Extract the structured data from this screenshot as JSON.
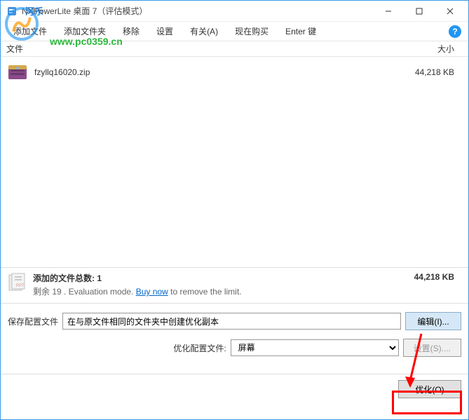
{
  "titlebar": {
    "title": "NXPowerLite 桌面 7（评估模式）"
  },
  "menubar": {
    "items": [
      "添加文件",
      "添加文件夹",
      "移除",
      "设置",
      "有关(A)",
      "现在购买",
      "Enter 键"
    ]
  },
  "list_header": {
    "file": "文件",
    "size": "大小"
  },
  "files": [
    {
      "name": "fzyllq16020.zip",
      "size": "44,218 KB"
    }
  ],
  "status": {
    "line1_prefix": "添加的文件总数: ",
    "count": "1",
    "line2_prefix": "剩余 19 . Evaluation mode. ",
    "buy_now": "Buy now",
    "line2_suffix": " to remove the limit.",
    "total_size": "44,218 KB"
  },
  "bottom": {
    "save_profile_label": "保存配置文件",
    "save_profile_value": "在与原文件相同的文件夹中创建优化副本",
    "edit_btn": "编辑(I)...",
    "optimize_profile_label": "优化配置文件:",
    "optimize_profile_value": "屏幕",
    "settings_btn": "设置(S)....",
    "optimize_btn": "优化(O)"
  },
  "watermark": {
    "site_name": "河乐软件网",
    "url": "www.pc0359.cn"
  }
}
